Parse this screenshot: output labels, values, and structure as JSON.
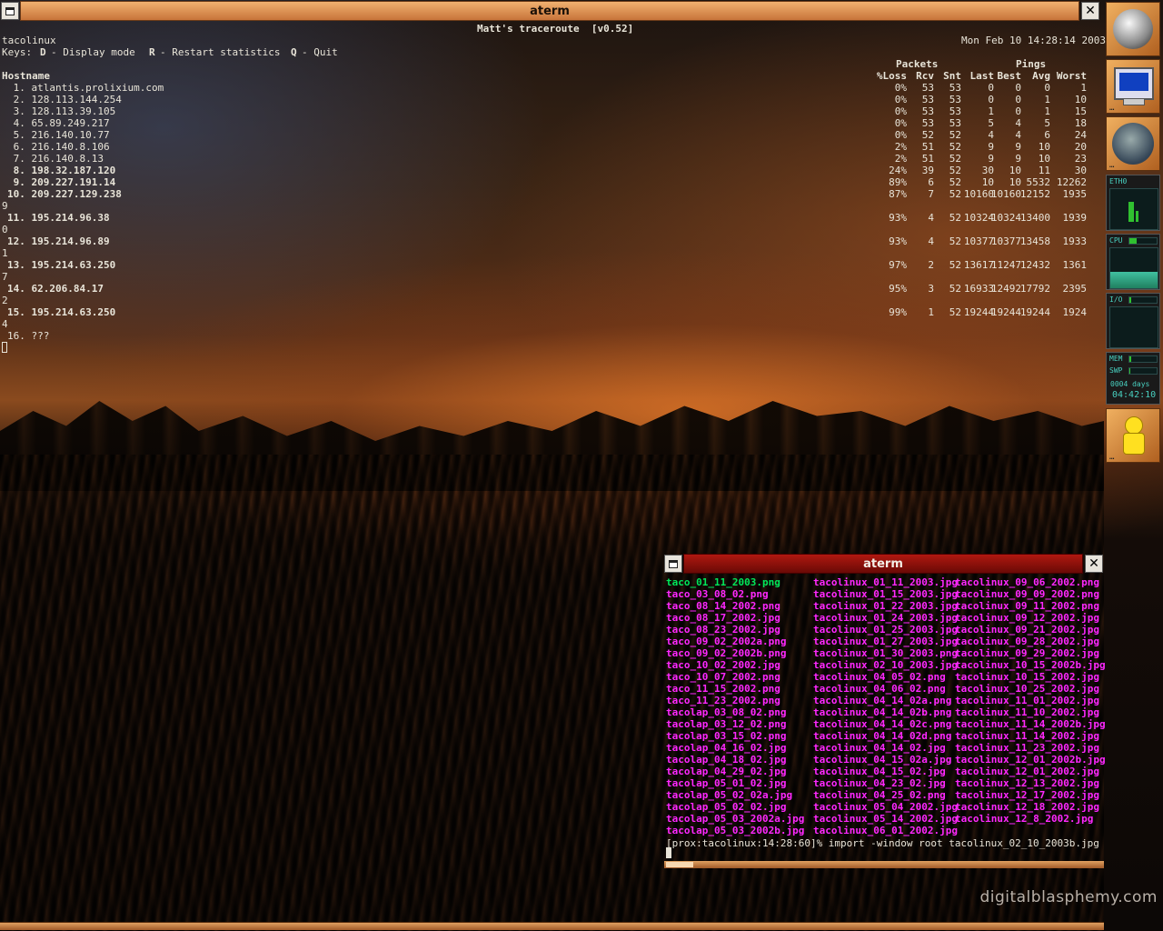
{
  "main_window": {
    "title": "aterm",
    "app_title": "Matt's traceroute  [v0.52]",
    "host": "tacolinux",
    "datetime": "Mon Feb 10 14:28:14 2003",
    "keys_label": "Keys:",
    "key_d": "D",
    "key_d_desc": "- Display mode",
    "key_r": "R",
    "key_r_desc": "- Restart statistics",
    "key_q": "Q",
    "key_q_desc": "- Quit",
    "packets_header": "Packets",
    "pings_header": "Pings",
    "hostname_header": "Hostname",
    "col_headers": [
      "%Loss",
      "Rcv",
      "Snt",
      "Last",
      "Best",
      "Avg",
      "Worst"
    ],
    "hops": [
      {
        "line": " 1. atlantis.prolixium.com",
        "bold": false,
        "stats": [
          "0%",
          "53",
          "53",
          "0",
          "0",
          "0",
          "1"
        ],
        "wrap": ""
      },
      {
        "line": " 2. 128.113.144.254",
        "bold": false,
        "stats": [
          "0%",
          "53",
          "53",
          "0",
          "0",
          "1",
          "10"
        ],
        "wrap": ""
      },
      {
        "line": " 3. 128.113.39.105",
        "bold": false,
        "stats": [
          "0%",
          "53",
          "53",
          "1",
          "0",
          "1",
          "15"
        ],
        "wrap": ""
      },
      {
        "line": " 4. 65.89.249.217",
        "bold": false,
        "stats": [
          "0%",
          "53",
          "53",
          "5",
          "4",
          "5",
          "18"
        ],
        "wrap": ""
      },
      {
        "line": " 5. 216.140.10.77",
        "bold": false,
        "stats": [
          "0%",
          "52",
          "52",
          "4",
          "4",
          "6",
          "24"
        ],
        "wrap": ""
      },
      {
        "line": " 6. 216.140.8.106",
        "bold": false,
        "stats": [
          "2%",
          "51",
          "52",
          "9",
          "9",
          "10",
          "20"
        ],
        "wrap": ""
      },
      {
        "line": " 7. 216.140.8.13",
        "bold": false,
        "stats": [
          "2%",
          "51",
          "52",
          "9",
          "9",
          "10",
          "23"
        ],
        "wrap": ""
      },
      {
        "line": " 8. 198.32.187.120",
        "bold": true,
        "stats": [
          "24%",
          "39",
          "52",
          "30",
          "10",
          "11",
          "30"
        ],
        "wrap": ""
      },
      {
        "line": " 9. 209.227.191.14",
        "bold": true,
        "stats": [
          "89%",
          "6",
          "52",
          "10",
          "10",
          "5532",
          "12262"
        ],
        "wrap": ""
      },
      {
        "line": "10. 209.227.129.238",
        "bold": true,
        "stats": [
          "87%",
          "7",
          "52",
          "10160",
          "10160",
          "12152",
          "1935"
        ],
        "wrap": "9"
      },
      {
        "line": "11. 195.214.96.38",
        "bold": true,
        "stats": [
          "93%",
          "4",
          "52",
          "10324",
          "10324",
          "13400",
          "1939"
        ],
        "wrap": "0"
      },
      {
        "line": "12. 195.214.96.89",
        "bold": true,
        "stats": [
          "93%",
          "4",
          "52",
          "10377",
          "10377",
          "13458",
          "1933"
        ],
        "wrap": "1"
      },
      {
        "line": "13. 195.214.63.250",
        "bold": true,
        "stats": [
          "97%",
          "2",
          "52",
          "13617",
          "11247",
          "12432",
          "1361"
        ],
        "wrap": "7"
      },
      {
        "line": "14. 62.206.84.17",
        "bold": true,
        "stats": [
          "95%",
          "3",
          "52",
          "16933",
          "12492",
          "17792",
          "2395"
        ],
        "wrap": "2"
      },
      {
        "line": "15. 195.214.63.250",
        "bold": true,
        "stats": [
          "99%",
          "1",
          "52",
          "19244",
          "19244",
          "19244",
          "1924"
        ],
        "wrap": "4"
      },
      {
        "line": "16. ???",
        "bold": false,
        "stats": [
          "",
          "",
          "",
          "",
          "",
          "",
          ""
        ],
        "wrap": ""
      }
    ]
  },
  "ls_window": {
    "title": "aterm",
    "columns": [
      [
        "taco_01_11_2003.png",
        "taco_03_08_02.png",
        "taco_08_14_2002.png",
        "taco_08_17_2002.jpg",
        "taco_08_23_2002.jpg",
        "taco_09_02_2002a.png",
        "taco_09_02_2002b.png",
        "taco_10_02_2002.jpg",
        "taco_10_07_2002.png",
        "taco_11_15_2002.png",
        "taco_11_23_2002.png",
        "tacolap_03_08_02.png",
        "tacolap_03_12_02.png",
        "tacolap_03_15_02.png",
        "tacolap_04_16_02.jpg",
        "tacolap_04_18_02.jpg",
        "tacolap_04_29_02.jpg",
        "tacolap_05_01_02.jpg",
        "tacolap_05_02_02a.jpg",
        "tacolap_05_02_02.jpg",
        "tacolap_05_03_2002a.jpg",
        "tacolap_05_03_2002b.jpg"
      ],
      [
        "tacolinux_01_11_2003.jpg",
        "tacolinux_01_15_2003.jpg",
        "tacolinux_01_22_2003.jpg",
        "tacolinux_01_24_2003.jpg",
        "tacolinux_01_25_2003.jpg",
        "tacolinux_01_27_2003.jpg",
        "tacolinux_01_30_2003.png",
        "tacolinux_02_10_2003.jpg",
        "tacolinux_04_05_02.png",
        "tacolinux_04_06_02.png",
        "tacolinux_04_14_02a.png",
        "tacolinux_04_14_02b.png",
        "tacolinux_04_14_02c.png",
        "tacolinux_04_14_02d.png",
        "tacolinux_04_14_02.jpg",
        "tacolinux_04_15_02a.jpg",
        "tacolinux_04_15_02.jpg",
        "tacolinux_04_23_02.jpg",
        "tacolinux_04_25_02.png",
        "tacolinux_05_04_2002.jpg",
        "tacolinux_05_14_2002.jpg",
        "tacolinux_06_01_2002.jpg"
      ],
      [
        "tacolinux_09_06_2002.png",
        "tacolinux_09_09_2002.png",
        "tacolinux_09_11_2002.png",
        "tacolinux_09_12_2002.jpg",
        "tacolinux_09_21_2002.jpg",
        "tacolinux_09_28_2002.jpg",
        "tacolinux_09_29_2002.jpg",
        "tacolinux_10_15_2002b.jpg",
        "tacolinux_10_15_2002.jpg",
        "tacolinux_10_25_2002.jpg",
        "tacolinux_11_01_2002.jpg",
        "tacolinux_11_10_2002.jpg",
        "tacolinux_11_14_2002b.jpg",
        "tacolinux_11_14_2002.jpg",
        "tacolinux_11_23_2002.jpg",
        "tacolinux_12_01_2002b.jpg",
        "tacolinux_12_01_2002.jpg",
        "tacolinux_12_13_2002.jpg",
        "tacolinux_12_17_2002.jpg",
        "tacolinux_12_18_2002.jpg",
        "tacolinux_12_8_2002.jpg",
        ""
      ]
    ],
    "prompt": "[prox:tacolinux:14:28:60]% import -window root tacolinux_02_10_2003b.jpg"
  },
  "dock": {
    "net_label": "ETH0",
    "cpu_label": "CPU",
    "io_label": "I/O",
    "mem_label": "MEM",
    "swp_label": "SWP",
    "uptime_days": "0004 days",
    "uptime_time": "04:42:10",
    "cpu_fill": 0.25,
    "mem_fill": 0.08,
    "swp_fill": 0.04,
    "io_fill": 0.06
  },
  "watermark": "digitalblasphemy.com",
  "colors": {
    "main_title_bar": "#d8884a",
    "ls_title_bar": "#9a1208",
    "ls_dir_green": "#00e85a",
    "ls_file_magenta": "#ff28ff"
  }
}
